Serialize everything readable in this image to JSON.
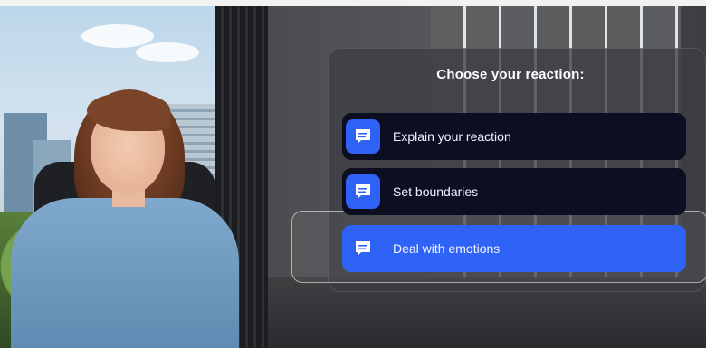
{
  "panel": {
    "title": "Choose your reaction:",
    "options": [
      {
        "label": "Explain your reaction",
        "icon": "chat-message-icon",
        "selected": false
      },
      {
        "label": "Set boundaries",
        "icon": "chat-message-icon",
        "selected": false
      },
      {
        "label": "Deal with emotions",
        "icon": "chat-message-icon",
        "selected": true
      }
    ]
  },
  "colors": {
    "accent": "#2e63f5",
    "option_bg": "#0d0e22",
    "panel_bg": "#3c3e44"
  }
}
